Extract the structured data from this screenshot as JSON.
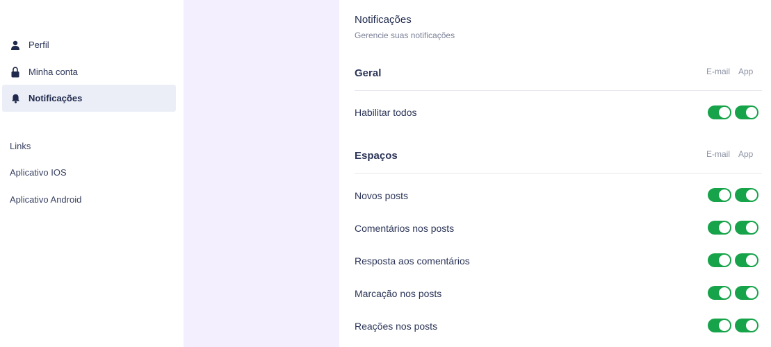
{
  "sidebar": {
    "nav": [
      {
        "label": "Perfil",
        "icon": "user-icon"
      },
      {
        "label": "Minha conta",
        "icon": "lock-icon"
      },
      {
        "label": "Notificações",
        "icon": "bell-icon",
        "active": true
      }
    ],
    "links": [
      {
        "label": "Links"
      },
      {
        "label": "Aplicativo IOS"
      },
      {
        "label": "Aplicativo Android"
      }
    ]
  },
  "main": {
    "title": "Notificações",
    "subtitle": "Gerencie suas notificações",
    "columns": {
      "email": "E-mail",
      "app": "App"
    },
    "sections": [
      {
        "title": "Geral",
        "rows": [
          {
            "label": "Habilitar todos",
            "email": true,
            "app": true
          }
        ]
      },
      {
        "title": "Espaços",
        "rows": [
          {
            "label": "Novos posts",
            "email": true,
            "app": true
          },
          {
            "label": "Comentários nos posts",
            "email": true,
            "app": true
          },
          {
            "label": "Resposta aos comentários",
            "email": true,
            "app": true
          },
          {
            "label": "Marcação nos posts",
            "email": true,
            "app": true
          },
          {
            "label": "Reações nos posts",
            "email": true,
            "app": true
          }
        ]
      }
    ]
  },
  "colors": {
    "accent": "#16a34a",
    "sidebar_active_bg": "#eceef7",
    "panel_bg": "#f4efff",
    "text": "#1f2a4d"
  }
}
